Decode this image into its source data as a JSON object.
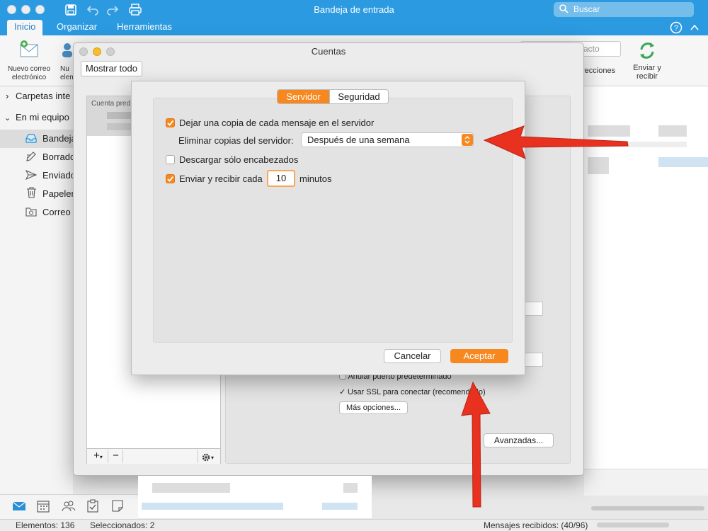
{
  "window": {
    "title": "Bandeja de entrada",
    "search_placeholder": "Buscar"
  },
  "ribbon": {
    "tabs": [
      "Inicio",
      "Organizar",
      "Herramientas"
    ],
    "new_email": [
      "Nuevo correo",
      "electrónico"
    ],
    "partial_new": [
      "Nu",
      "elem"
    ],
    "partial_contact": "acto",
    "partial_addresses": "recciones",
    "send_receive": [
      "Enviar y",
      "recibir"
    ]
  },
  "sidebar": {
    "groups": [
      "Carpetas inte",
      "En mi equipo"
    ],
    "folders": [
      "Bandeja",
      "Borrado",
      "Enviado",
      "Papeler",
      "Correo e"
    ]
  },
  "statusbar": {
    "items": "Elementos: 136",
    "selected": "Seleccionados: 2",
    "received": "Mensajes recibidos: (40/96)"
  },
  "accounts_window": {
    "title": "Cuentas",
    "show_all": "Mostrar todo",
    "list_header": "Cuenta pred",
    "add": "+",
    "remove": "−",
    "behind": {
      "override_port": "Anular puerto predeterminado",
      "use_ssl": "Usar SSL para conectar (recomendado)",
      "more_options": "Más opciones...",
      "advanced": "Avanzadas..."
    }
  },
  "dialog": {
    "tabs": {
      "server": "Servidor",
      "security": "Seguridad"
    },
    "leave_copy": "Dejar una copia de cada mensaje en el servidor",
    "delete_copies_label": "Eliminar copias del servidor:",
    "delete_copies_value": "Después de una semana",
    "headers_only": "Descargar sólo encabezados",
    "send_receive_every": "Enviar y recibir cada",
    "interval": "10",
    "minutes": "minutos",
    "cancel": "Cancelar",
    "accept": "Aceptar"
  },
  "colors": {
    "accent": "#2b9ae0",
    "orange": "#f7881f",
    "arrow": "#e8321f"
  }
}
